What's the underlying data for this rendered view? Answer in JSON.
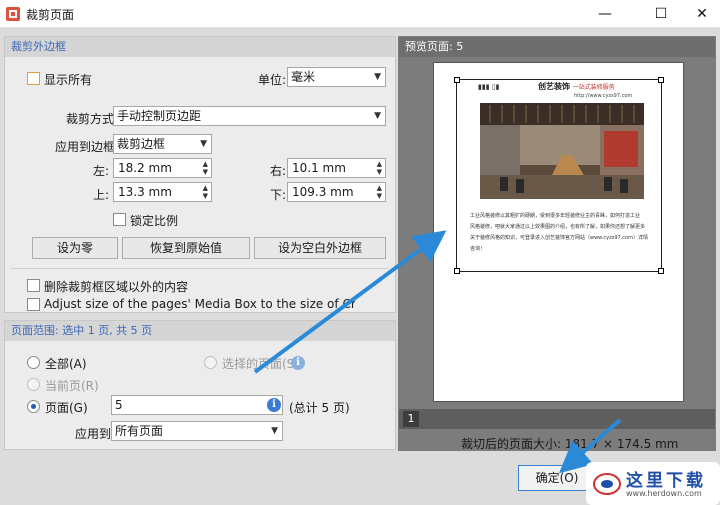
{
  "window": {
    "title": "裁剪页面",
    "minimize": "—",
    "maximize": "☐",
    "close": "✕"
  },
  "margins": {
    "title": "裁剪外边框",
    "show_all_label": "显示所有",
    "unit_label": "单位:",
    "unit_value": "毫米",
    "crop_method_label": "裁剪方式",
    "crop_method_value": "手动控制页边距",
    "apply_to_box_label": "应用到边框",
    "apply_to_box_value": "裁剪边框",
    "left_label": "左:",
    "left_value": "18.2 mm",
    "right_label": "右:",
    "right_value": "10.1 mm",
    "top_label": "上:",
    "top_value": "13.3 mm",
    "bottom_label": "下:",
    "bottom_value": "109.3 mm",
    "lock_ratio_label": "锁定比例",
    "set_zero_button": "设为零",
    "restore_button": "恢复到原始值",
    "set_blank_button": "设为空白外边框",
    "delete_outside_label": "删除裁剪框区域以外的内容",
    "adjust_media_label": "Adjust size of the pages' Media Box to the size of Crop Box"
  },
  "page_range": {
    "header": "页面范围: 选中 1 页, 共 5 页",
    "all_label": "全部(A)",
    "all_key": "A",
    "selected_pages_label": "选择的页面(S)",
    "current_page_label": "当前页(R)",
    "pages_label": "页面(G)",
    "pages_value": "5",
    "pages_total": "(总计 5 页)",
    "apply_to_label": "应用到:",
    "apply_to_value": "所有页面"
  },
  "preview": {
    "header": "预览页面: 5",
    "page_number": "1",
    "size_label": "裁切后的页面大小:  181.7 × 174.5 mm",
    "doc_brand": "创艺装饰",
    "doc_slogan": "一站式装修服务",
    "doc_url": "http://www.cyzs97.com",
    "doc_text": [
      "工业风格装修以其粗犷的硬朗，受到很多年轻装修业主的青睐，如何打造工业",
      "风格装修，吧就大家通过以上效果图的介绍，也有所了解，如果你还想了解更多",
      "关于装修风格的知识，可登录进入创艺装饰官方网站（www.cyzs97.com）详情",
      "咨询！"
    ]
  },
  "footer": {
    "ok_button": "确定(O)"
  },
  "watermark": {
    "name": "这里下载",
    "url": "www.herdown.com"
  }
}
